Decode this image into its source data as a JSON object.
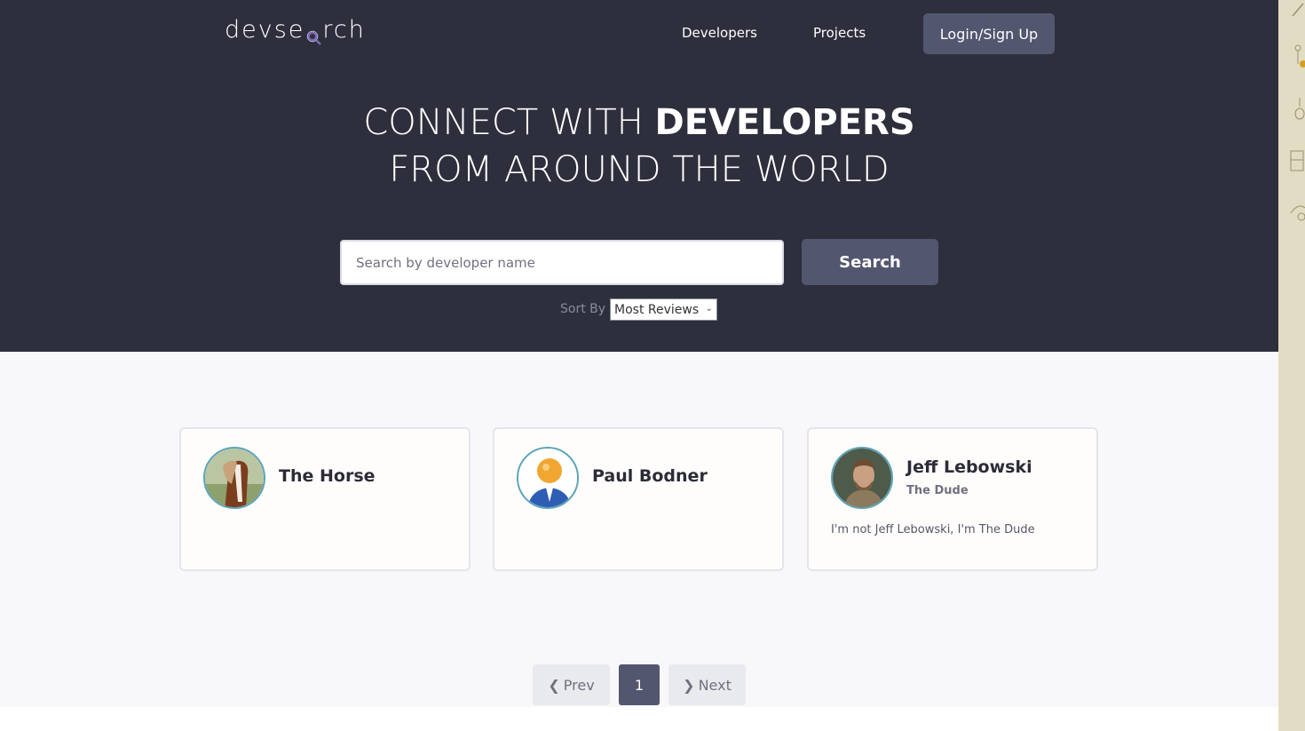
{
  "header": {
    "logo_text": "devsearch",
    "nav": [
      {
        "label": "Developers"
      },
      {
        "label": "Projects"
      }
    ],
    "login_label": "Login/Sign Up"
  },
  "hero": {
    "line1_light": "CONNECT WITH",
    "line1_bold": "DEVELOPERS",
    "line2": "FROM AROUND THE WORLD"
  },
  "search": {
    "placeholder": "Search by developer name",
    "value": "",
    "button_label": "Search",
    "sort_label": "Sort By",
    "sort_selected": "Most Reviews"
  },
  "developers": [
    {
      "name": "The Horse",
      "short_intro": "",
      "bio": "",
      "avatar_icon": "horse-photo"
    },
    {
      "name": "Paul Bodner",
      "short_intro": "",
      "bio": "",
      "avatar_icon": "default-user-avatar"
    },
    {
      "name": "Jeff Lebowski",
      "short_intro": "The Dude",
      "bio": "I'm not Jeff Lebowski, I'm The Dude",
      "avatar_icon": "man-photo"
    }
  ],
  "pagination": {
    "prev_label": "Prev",
    "current_page": "1",
    "next_label": "Next"
  },
  "colors": {
    "hero_bg": "#2e2f3d",
    "accent": "#53566f",
    "avatar_border": "#5aa3b8"
  }
}
